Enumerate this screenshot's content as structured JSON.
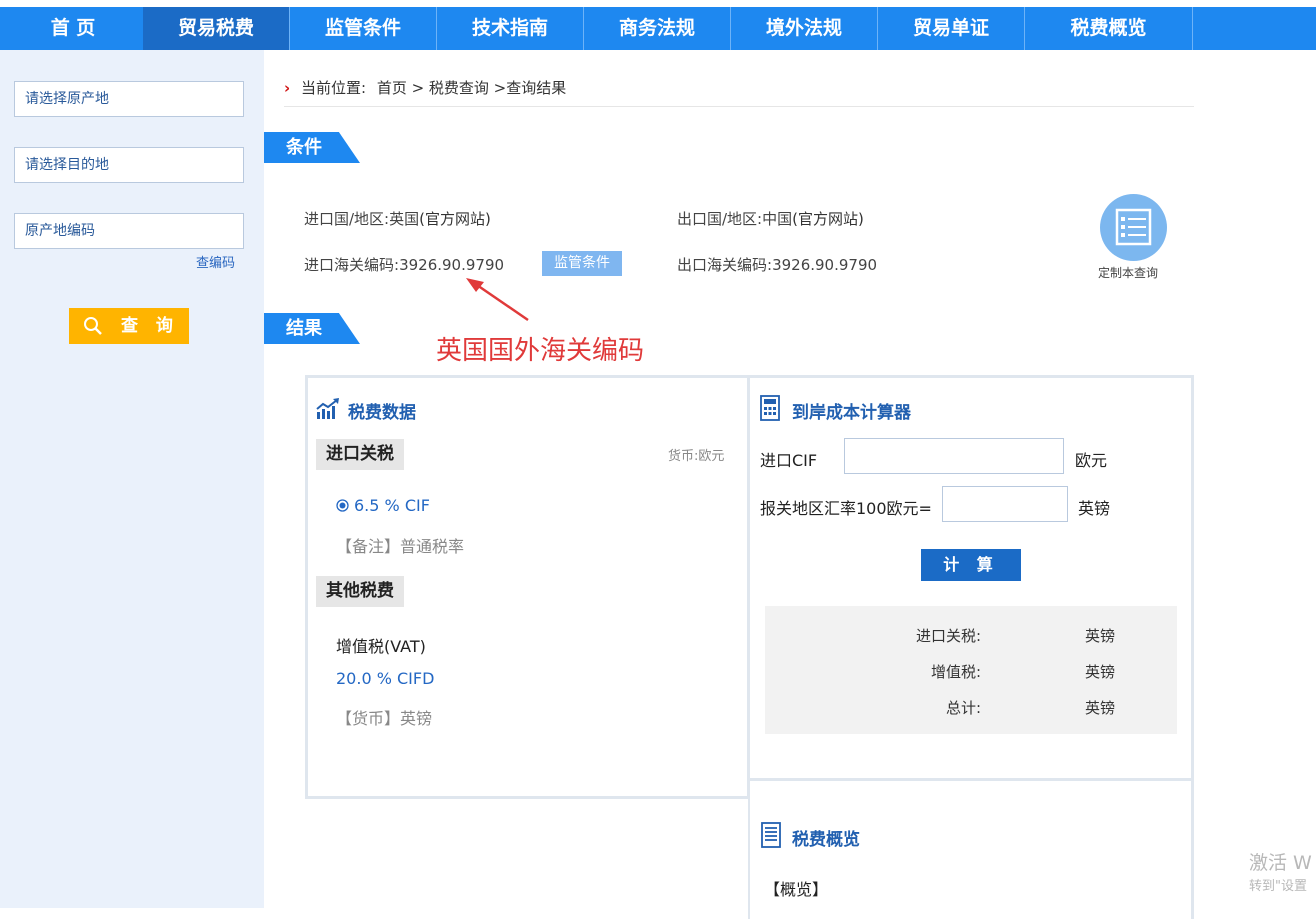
{
  "nav": {
    "items": [
      "首 页",
      "贸易税费",
      "监管条件",
      "技术指南",
      "商务法规",
      "境外法规",
      "贸易单证",
      "税费概览"
    ],
    "active_index": 1
  },
  "sidebar": {
    "origin_placeholder": "请选择原产地",
    "destination_placeholder": "请选择目的地",
    "origin_code_placeholder": "原产地编码",
    "lookup_code_link": "查编码",
    "search_button": "查 询"
  },
  "breadcrumb": {
    "prefix": "当前位置:",
    "path": "首页 > 税费查询 >查询结果"
  },
  "conditions": {
    "section_tag": "条件",
    "import_country_label": "进口国/地区:",
    "import_country": "英国",
    "import_site": "(官方网站)",
    "export_country_label": "出口国/地区:",
    "export_country": "中国",
    "export_site": "(官方网站)",
    "import_code_label": "进口海关编码:",
    "import_code": "3926.90.9790",
    "regulation_button": "监管条件",
    "export_code_label": "出口海关编码:",
    "export_code": "3926.90.9790",
    "custom_query_label": "定制本查询"
  },
  "annotation": {
    "text": "英国国外海关编码",
    "color": "#e03a3a"
  },
  "results": {
    "section_tag": "结果",
    "tax_data": {
      "title": "税费数据",
      "import_duty_head": "进口关税",
      "currency_note": "货币:欧元",
      "duty_rate": "6.5 % CIF",
      "duty_remark": "【备注】普通税率",
      "other_tax_head": "其他税费",
      "vat_label": "增值税(VAT)",
      "vat_rate": "20.0 % CIFD",
      "vat_currency": "【货币】英镑"
    },
    "calculator": {
      "title": "到岸成本计算器",
      "cif_label": "进口CIF",
      "cif_unit": "欧元",
      "rate_label": "报关地区汇率100欧元=",
      "rate_unit": "英镑",
      "calc_button": "计 算",
      "rows": [
        {
          "label": "进口关税:",
          "unit": "英镑"
        },
        {
          "label": "增值税:",
          "unit": "英镑"
        },
        {
          "label": "总计:",
          "unit": "英镑"
        }
      ]
    },
    "overview": {
      "title": "税费概览",
      "first_item": "【概览】"
    }
  },
  "watermark": {
    "line1": "激活 W",
    "line2": "转到\"设置"
  },
  "colors": {
    "nav_bg": "#1e88f0",
    "nav_active": "#1b6bc6",
    "sidebar_bg": "#eaf1fb",
    "search_btn": "#ffb400",
    "link_blue": "#2468c4"
  }
}
